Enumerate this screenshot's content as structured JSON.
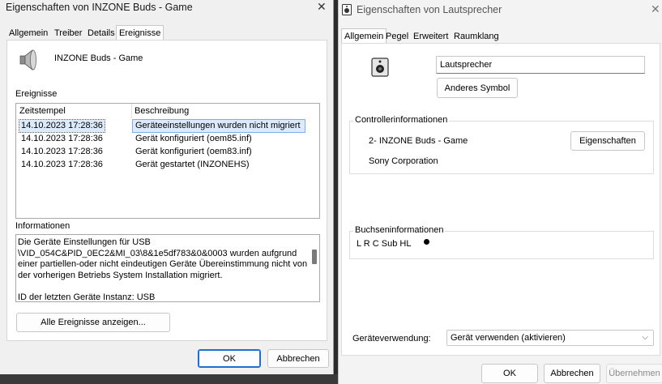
{
  "left": {
    "title": "Eigenschaften von INZONE Buds - Game",
    "tabs": [
      "Allgemein",
      "Treiber",
      "Details",
      "Ereignisse"
    ],
    "device_name": "INZONE Buds - Game",
    "events_label": "Ereignisse",
    "columns": [
      "Zeitstempel",
      "Beschreibung"
    ],
    "rows": [
      {
        "time": "14.10.2023 17:28:36",
        "desc": "Geräteeinstellungen wurden nicht migriert"
      },
      {
        "time": "14.10.2023 17:28:36",
        "desc": "Gerät konfiguriert (oem85.inf)"
      },
      {
        "time": "14.10.2023 17:28:36",
        "desc": "Gerät konfiguriert (oem83.inf)"
      },
      {
        "time": "14.10.2023 17:28:36",
        "desc": "Gerät gestartet (INZONEHS)"
      }
    ],
    "info_label": "Informationen",
    "info_lines": [
      "Die Geräte Einstellungen für USB",
      "\\VID_054C&PID_0EC2&MI_03\\8&1e5df783&0&0003 wurden aufgrund",
      "einer partiellen-oder nicht eindeutigen Geräte Übereinstimmung nicht von",
      "der vorherigen Betriebs System Installation migriert.",
      "",
      "ID der letzten Geräte Instanz:  USB"
    ],
    "all_events_btn": "Alle Ereignisse anzeigen...",
    "ok": "OK",
    "cancel": "Abbrechen"
  },
  "right": {
    "title": "Eigenschaften von Lautsprecher",
    "tabs": [
      "Allgemein",
      "Pegel",
      "Erweitert",
      "Raumklang"
    ],
    "name_value": "Lautsprecher",
    "change_icon_btn": "Anderes Symbol",
    "controller_legend": "Controllerinformationen",
    "controller_name": "2- INZONE Buds - Game",
    "controller_props_btn": "Eigenschaften",
    "manufacturer": "Sony Corporation",
    "jack_legend": "Buchseninformationen",
    "jack_text": "L R C Sub HL",
    "usage_label": "Geräteverwendung:",
    "usage_value": "Gerät verwenden (aktivieren)",
    "ok": "OK",
    "cancel": "Abbrechen",
    "apply": "Übernehmen"
  }
}
